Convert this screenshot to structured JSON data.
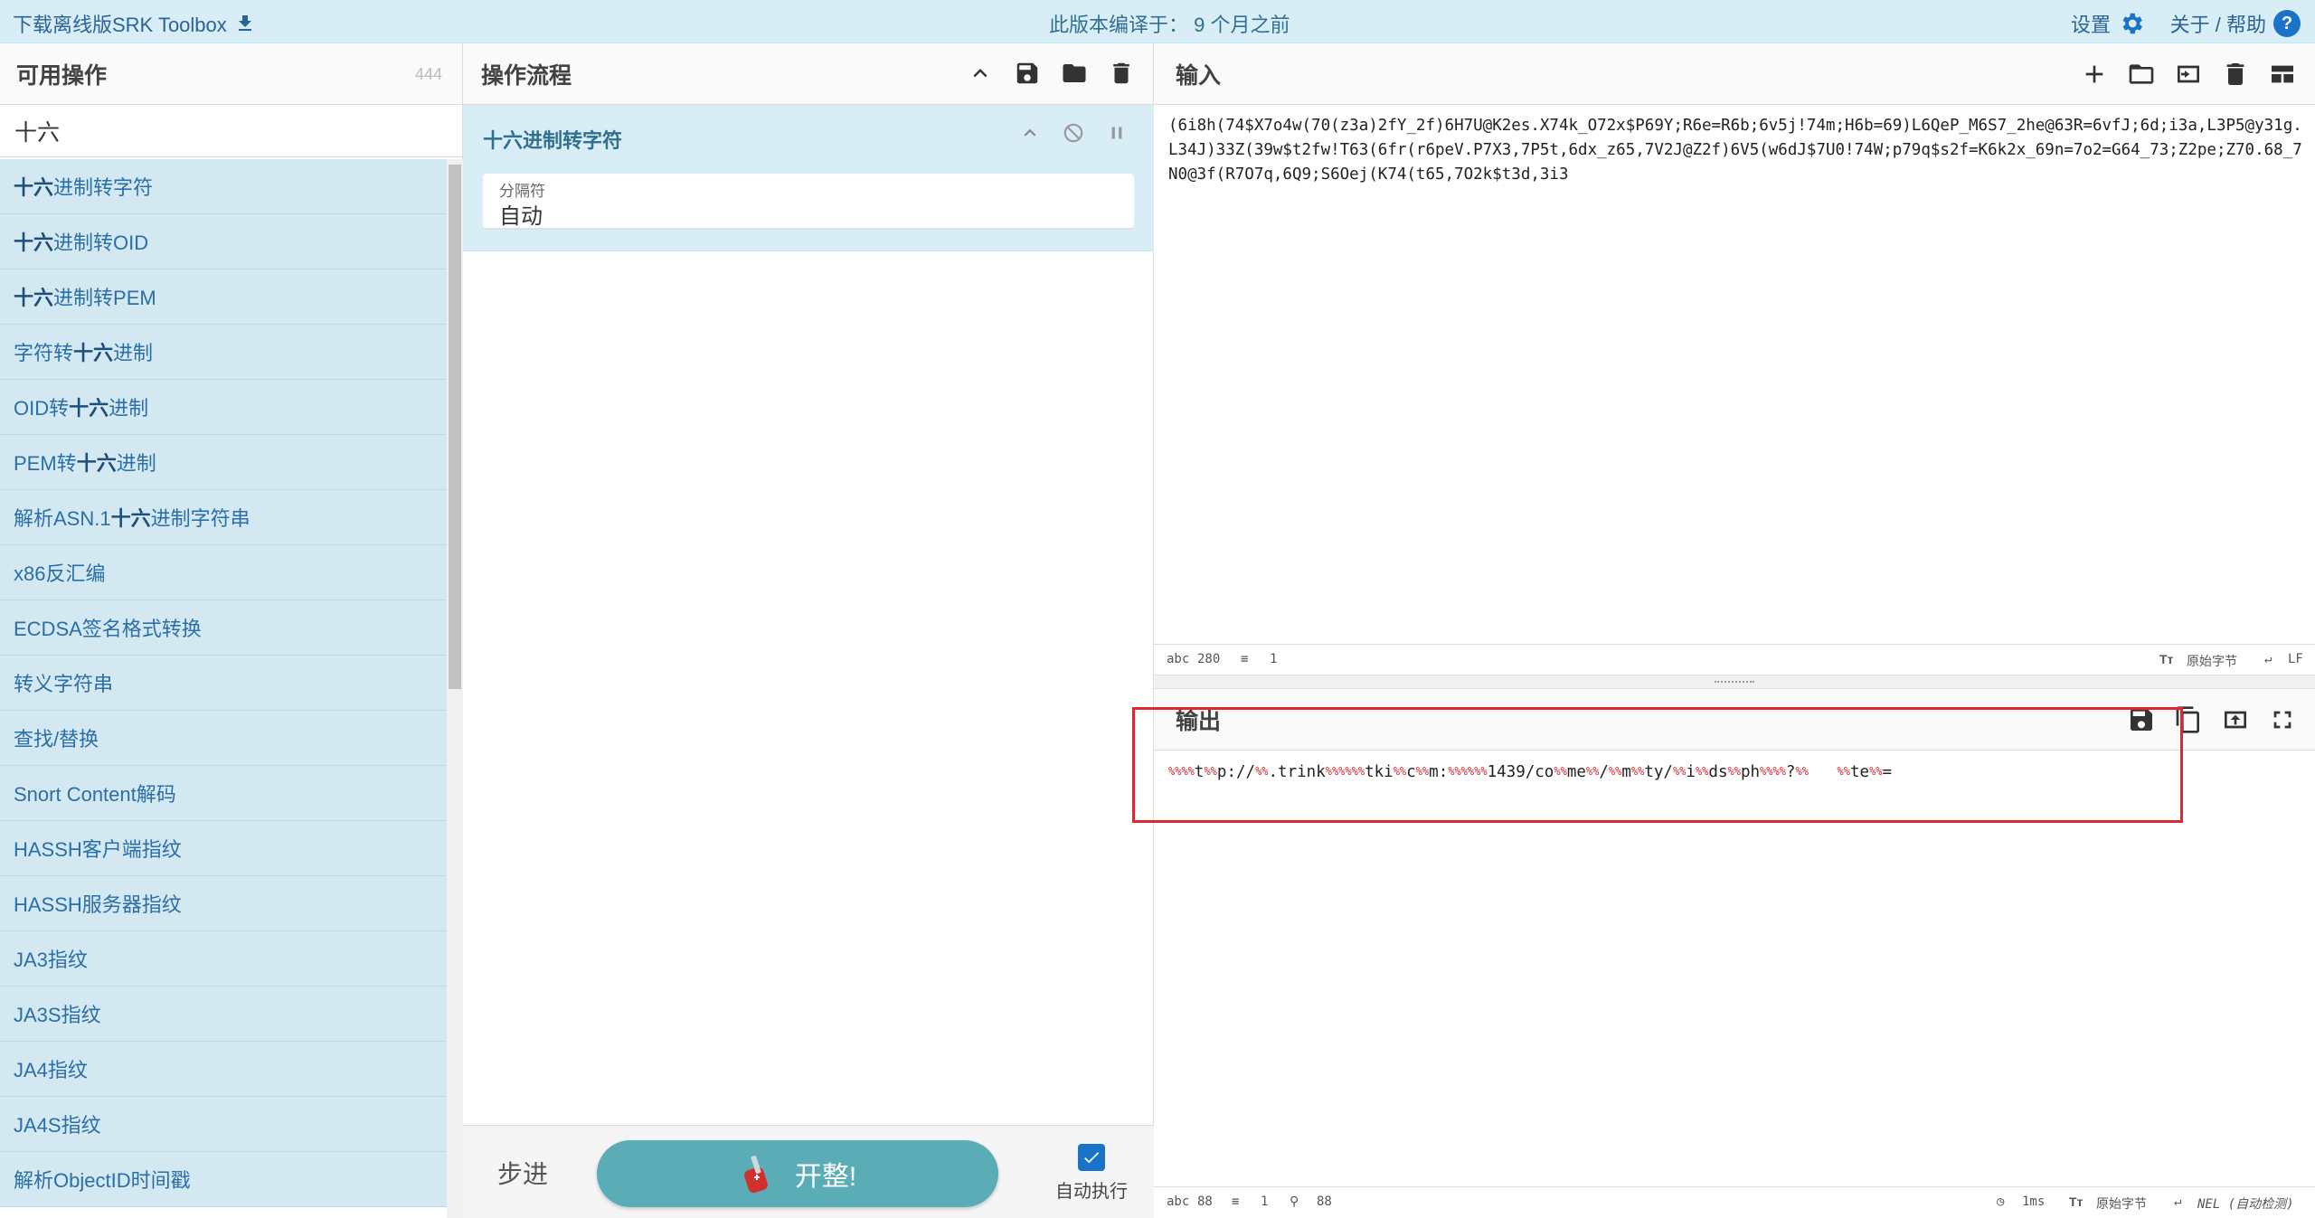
{
  "banner": {
    "download": "下载离线版SRK Toolbox",
    "version": "此版本编译于： 9 个月之前",
    "settings": "设置",
    "about": "关于 / 帮助"
  },
  "operations": {
    "title": "可用操作",
    "count": "444",
    "search_value": "十六",
    "items": [
      {
        "pre": "",
        "hl": "十六",
        "post": "进制转字符"
      },
      {
        "pre": "",
        "hl": "十六",
        "post": "进制转OID"
      },
      {
        "pre": "",
        "hl": "十六",
        "post": "进制转PEM"
      },
      {
        "pre": "字符转",
        "hl": "十六",
        "post": "进制"
      },
      {
        "pre": "OID转",
        "hl": "十六",
        "post": "进制"
      },
      {
        "pre": "PEM转",
        "hl": "十六",
        "post": "进制"
      },
      {
        "pre": "解析ASN.1",
        "hl": "十六",
        "post": "进制字符串"
      },
      {
        "pre": "x86反汇编",
        "hl": "",
        "post": ""
      },
      {
        "pre": "ECDSA签名格式转换",
        "hl": "",
        "post": ""
      },
      {
        "pre": "转义字符串",
        "hl": "",
        "post": ""
      },
      {
        "pre": "查找/替换",
        "hl": "",
        "post": ""
      },
      {
        "pre": "Snort Content解码",
        "hl": "",
        "post": ""
      },
      {
        "pre": "HASSH客户端指纹",
        "hl": "",
        "post": ""
      },
      {
        "pre": "HASSH服务器指纹",
        "hl": "",
        "post": ""
      },
      {
        "pre": "JA3指纹",
        "hl": "",
        "post": ""
      },
      {
        "pre": "JA3S指纹",
        "hl": "",
        "post": ""
      },
      {
        "pre": "JA4指纹",
        "hl": "",
        "post": ""
      },
      {
        "pre": "JA4S指纹",
        "hl": "",
        "post": ""
      },
      {
        "pre": "解析ObjectID时间戳",
        "hl": "",
        "post": ""
      }
    ]
  },
  "recipe": {
    "title": "操作流程",
    "op_name": "十六进制转字符",
    "arg_label": "分隔符",
    "arg_value": "自动",
    "step": "步进",
    "bake": "开整!",
    "auto_bake": "自动执行"
  },
  "input": {
    "title": "输入",
    "text": "(6i8h(74$X7o4w(70(z3a)2fY_2f)6H7U@K2es.X74k_O72x$P69Y;R6e=R6b;6v5j!74m;H6b=69)L6QeP_M6S7_2he@63R=6vfJ;6d;i3a,L3P5@y31g.L34J)33Z(39w$t2fw!T63(6fr(r6peV.P7X3,7P5t,6dx_z65,7V2J@Z2f)6V5(w6dJ$7U0!74W;p79q$s2f=K6k2x_69n=7o2=G64_73;Z2pe;Z70.68_7N0@3f(R7O7q,6Q9;S6Oej(K74(t65,7O2k$t3d,3i3",
    "status_chars": "280",
    "status_lines": "1",
    "raw_bytes": "原始字节",
    "eol": "LF"
  },
  "output": {
    "title": "输出",
    "segments": [
      {
        "t": "",
        "esc": "%%"
      },
      {
        "t": "t",
        "esc": "%%"
      },
      {
        "t": "p://",
        "esc": "%%"
      },
      {
        "t": ".trink",
        "esc": "%%"
      },
      {
        "t": "tki",
        "esc": "%%%%%%"
      },
      {
        "t": "c",
        "esc": "%%"
      },
      {
        "t": "m:",
        "esc": "%%"
      },
      {
        "t": "1439/co",
        "esc": "%%%%%%"
      },
      {
        "t": "me",
        "esc": "%%"
      },
      {
        "t": "/",
        "esc": "%%"
      },
      {
        "t": "m",
        "esc": "%%"
      },
      {
        "t": "ty/",
        "esc": "%%"
      },
      {
        "t": "i",
        "esc": "%%"
      },
      {
        "t": "ds",
        "esc": "%%"
      },
      {
        "t": "ph",
        "esc": "%%"
      },
      {
        "t": "?",
        "esc": "%%%%"
      },
      {
        "t": "   ",
        "esc": "%%"
      },
      {
        "t": "te",
        "esc": "%%"
      },
      {
        "t": "=",
        "esc": "%%"
      }
    ],
    "status_chars": "88",
    "status_lines": "1",
    "status_pos": "88",
    "time": "1ms",
    "raw_bytes": "原始字节",
    "eol": "NEL (自动检测)"
  },
  "colors": {
    "accent": "#1a73c8",
    "highlight_box": "#e0262f",
    "bake": "#5aadb7"
  }
}
